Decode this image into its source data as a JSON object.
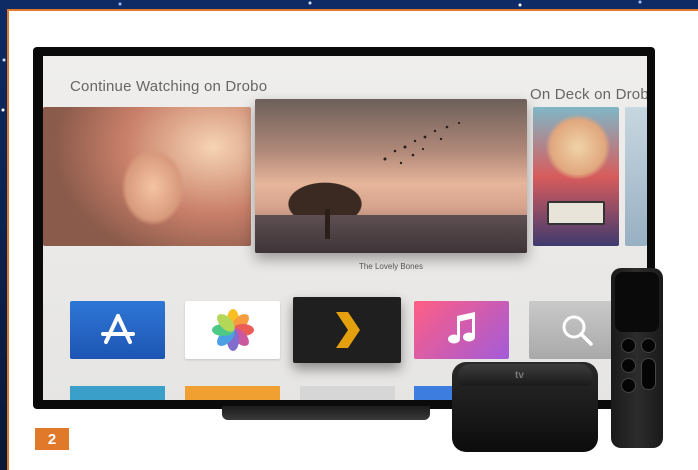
{
  "screen": {
    "continue_title": "Continue Watching on Drobo",
    "ondeck_title": "On Deck on Drob",
    "featured_caption": "The Lovely Bones"
  },
  "apps": [
    {
      "name": "App Store",
      "icon": "app-store-icon",
      "color": "#2f77d6"
    },
    {
      "name": "Photos",
      "icon": "photos-icon",
      "color": "#ffffff"
    },
    {
      "name": "Plex",
      "icon": "plex-chevron-icon",
      "color": "#e5a00d"
    },
    {
      "name": "Music",
      "icon": "music-note-icon",
      "color": "#ff5e84"
    },
    {
      "name": "Search",
      "icon": "search-icon",
      "color": "#bcbcbc"
    }
  ],
  "device": {
    "logo_text": "tv"
  },
  "figure_badge": "2",
  "colors": {
    "accent": "#e07a2a"
  }
}
